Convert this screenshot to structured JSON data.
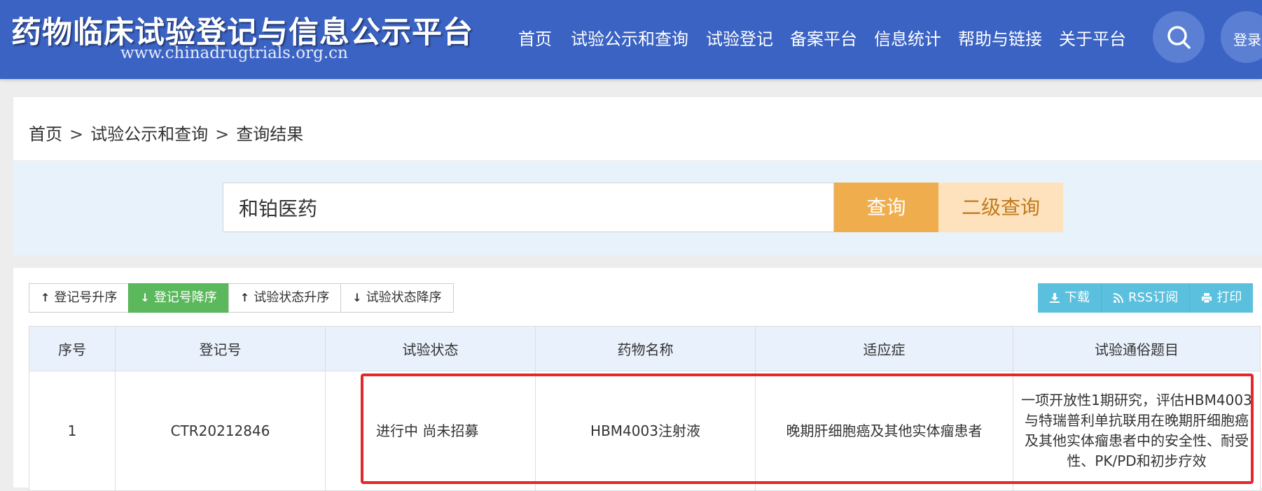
{
  "header": {
    "title": "药物临床试验登记与信息公示平台",
    "url": "www.chinadrugtrials.org.cn",
    "nav": [
      {
        "label": "首页"
      },
      {
        "label": "试验公示和查询"
      },
      {
        "label": "试验登记"
      },
      {
        "label": "备案平台"
      },
      {
        "label": "信息统计"
      },
      {
        "label": "帮助与链接"
      },
      {
        "label": "关于平台"
      }
    ],
    "login_label": "登录"
  },
  "breadcrumb": {
    "items": [
      "首页",
      "试验公示和查询",
      "查询结果"
    ],
    "separator": ">"
  },
  "search": {
    "value": "和铂医药",
    "query_button": "查询",
    "advanced_button": "二级查询"
  },
  "sort_buttons": [
    {
      "label": "登记号升序",
      "direction": "up",
      "active": false
    },
    {
      "label": "登记号降序",
      "direction": "down",
      "active": true
    },
    {
      "label": "试验状态升序",
      "direction": "up",
      "active": false
    },
    {
      "label": "试验状态降序",
      "direction": "down",
      "active": false
    }
  ],
  "actions": [
    {
      "label": "下载",
      "icon": "download-icon"
    },
    {
      "label": "RSS订阅",
      "icon": "rss-icon"
    },
    {
      "label": "打印",
      "icon": "print-icon"
    }
  ],
  "table": {
    "headers": [
      "序号",
      "登记号",
      "试验状态",
      "药物名称",
      "适应症",
      "试验通俗题目"
    ],
    "rows": [
      {
        "index": "1",
        "reg_no": "CTR20212846",
        "status": "进行中 尚未招募",
        "drug": "HBM4003注射液",
        "indication": "晚期肝细胞癌及其他实体瘤患者",
        "title": "一项开放性1期研究，评估HBM4003与特瑞普利单抗联用在晚期肝细胞癌及其他实体瘤患者中的安全性、耐受性、PK/PD和初步疗效"
      }
    ]
  },
  "colors": {
    "header_bg": "#3b63c4",
    "query_button": "#f0ad4e",
    "advanced_button": "#fde2bd",
    "active_sort": "#5cb85c",
    "action_button": "#5bc0de",
    "highlight_border": "#e5262a"
  }
}
